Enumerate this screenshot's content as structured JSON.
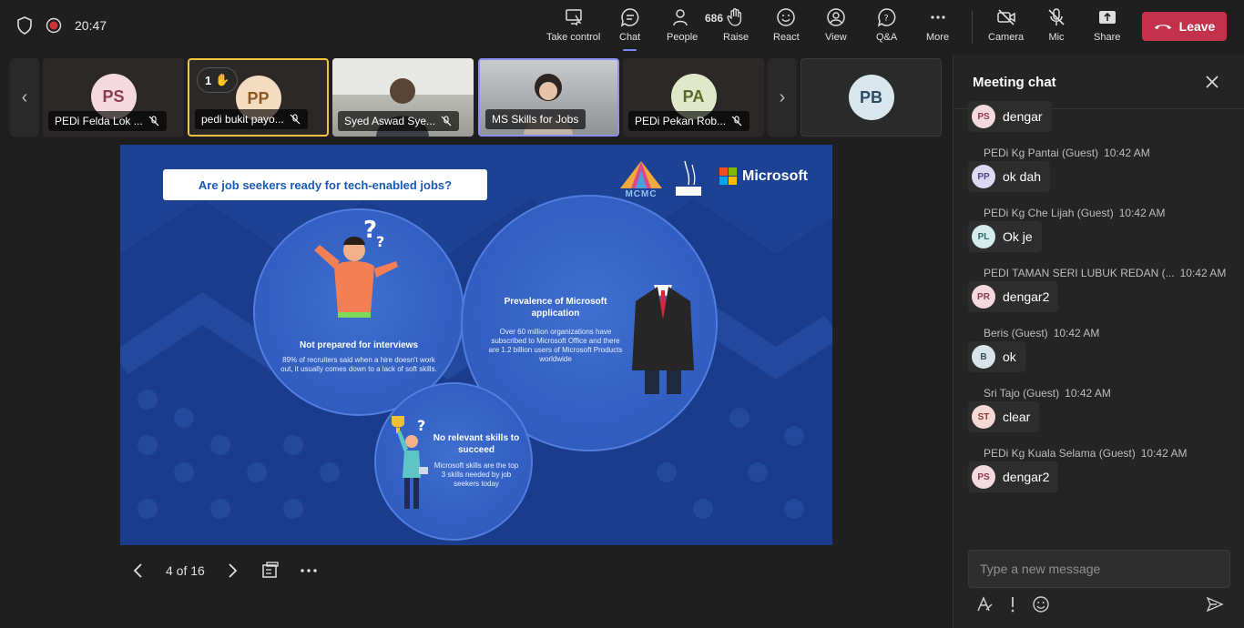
{
  "meeting": {
    "time": "20:47"
  },
  "toolbar": {
    "take_control": "Take control",
    "chat": "Chat",
    "people": "People",
    "people_count": "686",
    "raise": "Raise",
    "react": "React",
    "view": "View",
    "qa": "Q&A",
    "more": "More",
    "camera": "Camera",
    "mic": "Mic",
    "share": "Share",
    "leave": "Leave"
  },
  "participants": [
    {
      "initials": "PS",
      "name": "PEDi Felda Lok ...",
      "avatar_bg": "#f4d9de",
      "avatar_fg": "#8c3c52"
    },
    {
      "initials": "PP",
      "name": "pedi bukit payo...",
      "avatar_bg": "#f3dcc0",
      "avatar_fg": "#8a5a22",
      "hand_count": "1"
    },
    {
      "initials": "",
      "name": "Syed Aswad Sye..."
    },
    {
      "initials": "",
      "name": "MS Skills for Jobs"
    },
    {
      "initials": "PA",
      "name": "PEDi Pekan Rob...",
      "avatar_bg": "#dfe8c8",
      "avatar_fg": "#5a6a2a"
    },
    {
      "initials": "PB",
      "avatar_bg": "#d9e6ee",
      "avatar_fg": "#2b4d63"
    }
  ],
  "slide": {
    "title": "Are job seekers ready for tech-enabled jobs?",
    "mcmc": "MCMC",
    "microsoft": "Microsoft",
    "c1_title": "Not prepared for interviews",
    "c1_text": "89% of recruiters said when a hire doesn't work out, it usually comes down to a lack of soft skills.",
    "c2_title": "Prevalence of Microsoft application",
    "c2_text": "Over 60 million organizations have subscribed to Microsoft Office and there are 1.2 billion users of Microsoft Products worldwide",
    "c3_title": "No relevant skills to succeed",
    "c3_text": "Microsoft skills are the top 3 skills needed by job seekers today",
    "colors": {
      "bg": "#1b3c8c",
      "circle": "#3565c8",
      "title_text": "#1a5bb8"
    }
  },
  "slide_nav": {
    "page": "4 of 16"
  },
  "chat": {
    "title": "Meeting chat",
    "compose_placeholder": "Type a new message",
    "messages": [
      {
        "sender": "",
        "time": "",
        "text": "dengar",
        "initials": "PS",
        "av_bg": "#f4d9de",
        "av_fg": "#8c3c52"
      },
      {
        "sender": "PEDi Kg Pantai (Guest)",
        "time": "10:42 AM",
        "text": "ok dah",
        "initials": "PP",
        "av_bg": "#ddd9f3",
        "av_fg": "#4e4a8a"
      },
      {
        "sender": "PEDi Kg Che Lijah (Guest)",
        "time": "10:42 AM",
        "text": "Ok je",
        "initials": "PL",
        "av_bg": "#d5ecec",
        "av_fg": "#2d6b6b"
      },
      {
        "sender": "PEDI TAMAN SERI LUBUK REDAN (...",
        "time": "10:42 AM",
        "text": "dengar2",
        "initials": "PR",
        "av_bg": "#f4d9de",
        "av_fg": "#8c3c52"
      },
      {
        "sender": "Beris (Guest)",
        "time": "10:42 AM",
        "text": "ok",
        "initials": "B",
        "av_bg": "#d9e3ea",
        "av_fg": "#34505f"
      },
      {
        "sender": "Sri Tajo (Guest)",
        "time": "10:42 AM",
        "text": "clear",
        "initials": "ST",
        "av_bg": "#f3d8d3",
        "av_fg": "#8a3e30"
      },
      {
        "sender": "PEDi Kg Kuala Selama (Guest)",
        "time": "10:42 AM",
        "text": "dengar2",
        "initials": "PS",
        "av_bg": "#f4d9de",
        "av_fg": "#8c3c52"
      }
    ]
  }
}
